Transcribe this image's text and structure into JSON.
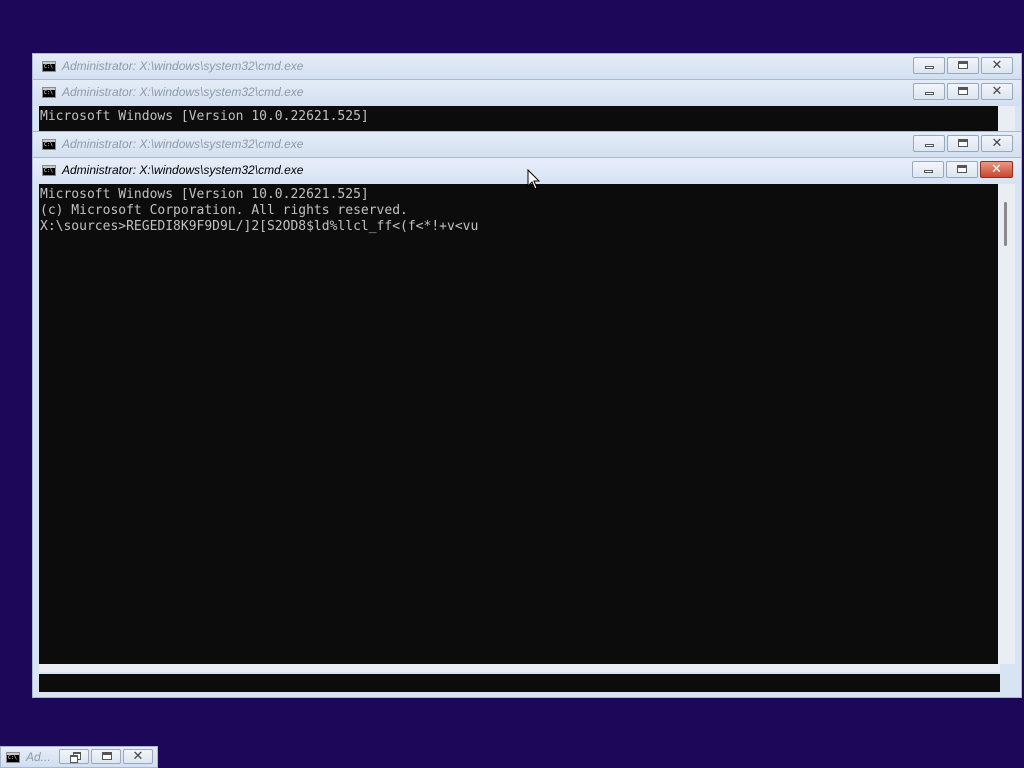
{
  "desktop": {
    "background_color": "#1c0758"
  },
  "windows": [
    {
      "title": "Administrator: X:\\windows\\system32\\cmd.exe",
      "state": "inactive"
    },
    {
      "title": "Administrator: X:\\windows\\system32\\cmd.exe",
      "state": "inactive",
      "console_lines": [
        "Microsoft Windows [Version 10.0.22621.525]"
      ]
    },
    {
      "title": "Administrator: X:\\windows\\system32\\cmd.exe",
      "state": "inactive"
    },
    {
      "title": "Administrator: X:\\windows\\system32\\cmd.exe",
      "state": "active",
      "console_lines": [
        "Microsoft Windows [Version 10.0.22621.525]",
        "(c) Microsoft Corporation. All rights reserved.",
        "",
        "X:\\sources>REGEDI8K9F9D9L/]2[S2OD8$ld%llcl_ff<(f<*!+v<vu"
      ]
    }
  ],
  "minimized_window": {
    "title": "Ad..."
  },
  "icons": {
    "window_icon": "cmd-console-icon",
    "minimize": "minimize-icon",
    "maximize": "maximize-icon",
    "restore": "restore-icon",
    "close": "close-icon",
    "pointer": "mouse-pointer-icon"
  },
  "colors": {
    "console_bg": "#0c0c0c",
    "console_text": "#c0c0c0",
    "titlebar": "#d9e4f2",
    "close_active": "#c9452e"
  }
}
